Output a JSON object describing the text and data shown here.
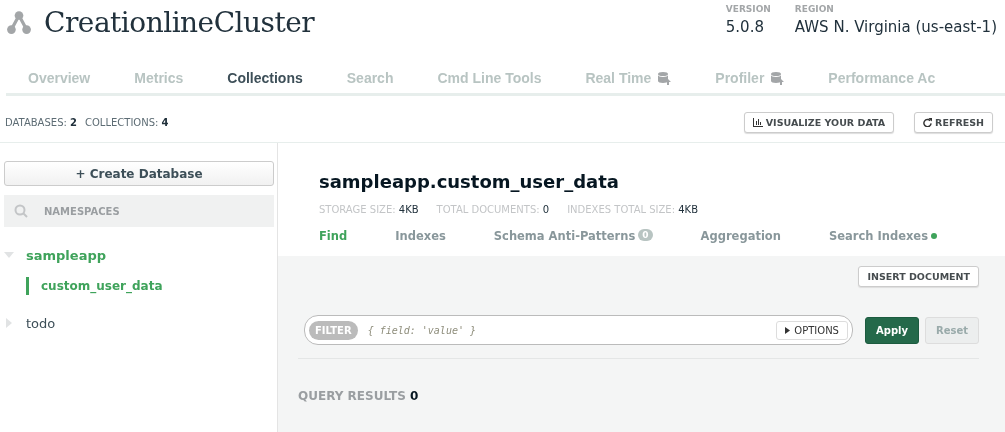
{
  "cluster": {
    "name": "CreationlineCluster",
    "version_label": "VERSION",
    "version": "5.0.8",
    "region_label": "REGION",
    "region": "AWS N. Virginia (us-east-1)"
  },
  "tabs": [
    {
      "label": "Overview",
      "selected": false,
      "kind": "plain"
    },
    {
      "label": "Metrics",
      "selected": false,
      "kind": "plain"
    },
    {
      "label": "Collections",
      "selected": true,
      "kind": "plain"
    },
    {
      "label": "Search",
      "selected": false,
      "kind": "plain"
    },
    {
      "label": "Cmd Line Tools",
      "selected": false,
      "kind": "plain"
    },
    {
      "label": "Real Time",
      "selected": false,
      "kind": "upgrade"
    },
    {
      "label": "Profiler",
      "selected": false,
      "kind": "upgrade"
    },
    {
      "label": "Performance Ac",
      "selected": false,
      "kind": "plain"
    }
  ],
  "stats": [
    {
      "label": "DATABASES:",
      "value": "2"
    },
    {
      "label": "COLLECTIONS:",
      "value": "4"
    }
  ],
  "toolbar_buttons": [
    {
      "label": "VISUALIZE YOUR DATA",
      "kind": "chart"
    },
    {
      "label": "REFRESH",
      "kind": "refresh"
    }
  ],
  "sidebar": {
    "create_button": "+ Create Database",
    "search": {
      "placeholder": "NAMESPACES"
    },
    "tree": [
      {
        "label": "sampleapp",
        "expanded": true,
        "children": [
          {
            "label": "custom_user_data",
            "selected": true
          }
        ]
      },
      {
        "label": "todo",
        "expanded": false
      }
    ]
  },
  "collection": {
    "title": "sampleapp.custom_user_data",
    "stats": [
      {
        "label": "STORAGE SIZE:",
        "value": "4KB"
      },
      {
        "label": "TOTAL DOCUMENTS:",
        "value": "0"
      },
      {
        "label": "INDEXES TOTAL SIZE:",
        "value": "4KB"
      }
    ],
    "tabs": [
      {
        "label": "Find",
        "selected": true
      },
      {
        "label": "Indexes",
        "selected": false
      },
      {
        "label": "Schema Anti-Patterns",
        "selected": false,
        "badge": "0"
      },
      {
        "label": "Aggregation",
        "selected": false
      },
      {
        "label": "Search Indexes",
        "selected": false,
        "color": "#3fa35b"
      }
    ],
    "insert_button": "INSERT DOCUMENT",
    "filter": {
      "tag": "FILTER",
      "placeholder": "{ field: 'value' }",
      "options": "OPTIONS"
    },
    "apply": {
      "label": "Apply",
      "disabled": false
    },
    "reset": {
      "label": "Reset",
      "disabled": true
    },
    "results": {
      "label": "QUERY RESULTS",
      "count": "0"
    }
  }
}
